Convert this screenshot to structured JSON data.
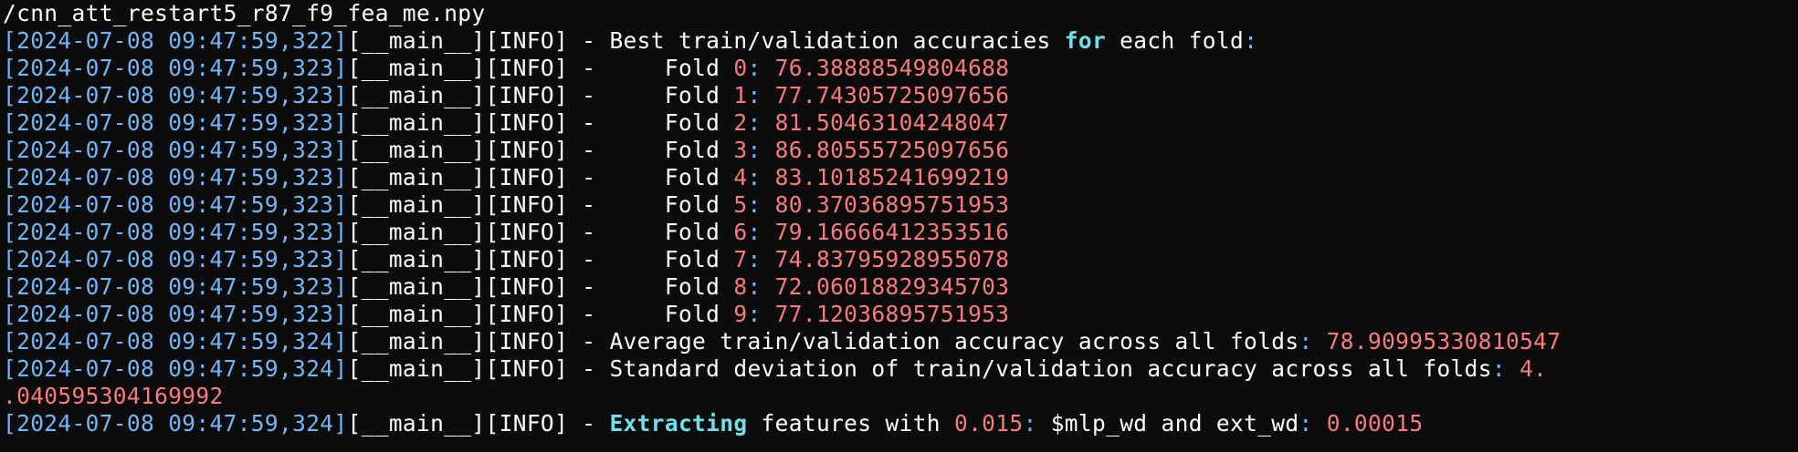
{
  "colors": {
    "background": "#0c0c0c",
    "timestamp": "#72b6f6",
    "number": "#f77b7b",
    "keyword": "#6ee0ec",
    "text": "#ffffff"
  },
  "terminal": {
    "first_line": "/cnn_att_restart5_r87_f9_fea_me.npy",
    "logger": "[__main__][INFO]",
    "dash": " - ",
    "header": {
      "timestamp": "[2024-07-08 09:47:59,322]",
      "text_a": "Best train/validation accuracies ",
      "kw": "for",
      "text_b": " each fold",
      "colon": ":"
    },
    "fold_prefix": "    Fold ",
    "folds": [
      {
        "timestamp": "[2024-07-08 09:47:59,323]",
        "idx": "0",
        "value": "76.38888549804688"
      },
      {
        "timestamp": "[2024-07-08 09:47:59,323]",
        "idx": "1",
        "value": "77.74305725097656"
      },
      {
        "timestamp": "[2024-07-08 09:47:59,323]",
        "idx": "2",
        "value": "81.50463104248047"
      },
      {
        "timestamp": "[2024-07-08 09:47:59,323]",
        "idx": "3",
        "value": "86.80555725097656"
      },
      {
        "timestamp": "[2024-07-08 09:47:59,323]",
        "idx": "4",
        "value": "83.10185241699219"
      },
      {
        "timestamp": "[2024-07-08 09:47:59,323]",
        "idx": "5",
        "value": "80.37036895751953"
      },
      {
        "timestamp": "[2024-07-08 09:47:59,323]",
        "idx": "6",
        "value": "79.16666412353516"
      },
      {
        "timestamp": "[2024-07-08 09:47:59,323]",
        "idx": "7",
        "value": "74.83795928955078"
      },
      {
        "timestamp": "[2024-07-08 09:47:59,323]",
        "idx": "8",
        "value": "72.06018829345703"
      },
      {
        "timestamp": "[2024-07-08 09:47:59,323]",
        "idx": "9",
        "value": "77.12036895751953"
      }
    ],
    "average": {
      "timestamp": "[2024-07-08 09:47:59,324]",
      "text": "Average train/validation accuracy across all folds",
      "value": "78.90995330810547"
    },
    "stddev": {
      "timestamp": "[2024-07-08 09:47:59,324]",
      "text": "Standard deviation of train/validation accuracy across all folds",
      "value_part1": "4.",
      "value_part2": ".040595304169992"
    },
    "extract": {
      "timestamp": "[2024-07-08 09:47:59,324]",
      "kw": "Extracting",
      "text_a": " features with ",
      "num1": "0.015",
      "text_b": " $mlp_wd and ext_wd",
      "num2": "0.00015"
    }
  }
}
